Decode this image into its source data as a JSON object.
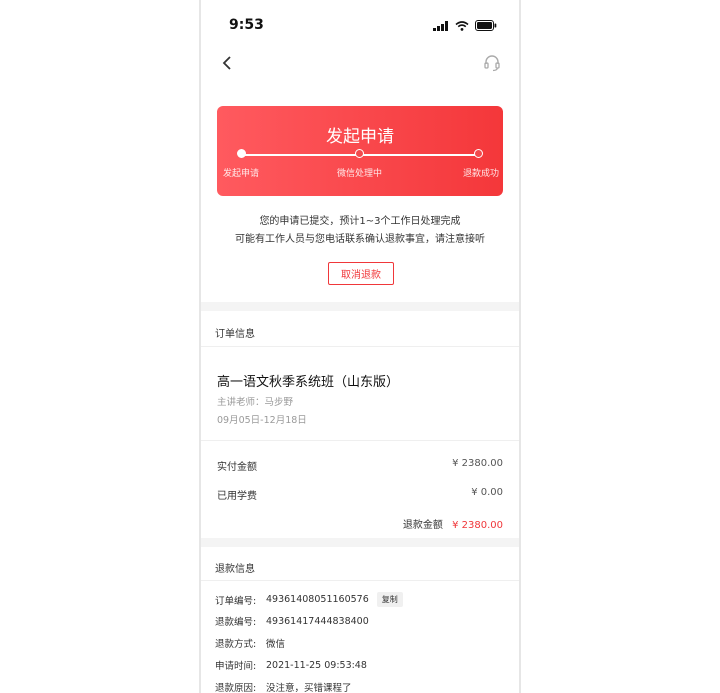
{
  "status_bar": {
    "time": "9:53"
  },
  "icons": {
    "back": "chevron-left-icon",
    "service": "headset-icon"
  },
  "hero": {
    "title": "发起申请",
    "steps": [
      "发起申请",
      "微信处理中",
      "退款成功"
    ],
    "completed_steps": 1
  },
  "notice": {
    "line1": "您的申请已提交，预计1~3个工作日处理完成",
    "line2": "可能有工作人员与您电话联系确认退款事宜，请注意接听",
    "cancel_label": "取消退款"
  },
  "order": {
    "section_title": "订单信息",
    "course_name": "高一语文秋季系统班（山东版）",
    "teacher": "主讲老师：马步野",
    "dates": "09月05日-12月18日",
    "paid_label": "实付金额",
    "paid_value": "¥ 2380.00",
    "used_label": "已用学费",
    "used_value": "¥ 0.00",
    "refund_label": "退款金额",
    "refund_value": "¥ 2380.00"
  },
  "refund": {
    "section_title": "退款信息",
    "rows": [
      {
        "key": "订单编号:",
        "value": "49361408051160576"
      },
      {
        "key": "退款编号:",
        "value": "49361417444838400"
      },
      {
        "key": "退款方式:",
        "value": "微信"
      },
      {
        "key": "申请时间:",
        "value": "2021-11-25 09:53:48"
      },
      {
        "key": "退款原因:",
        "value": "没注意，买错课程了"
      }
    ],
    "copy_label": "复制"
  },
  "colors": {
    "accent": "#f0373a",
    "hero_start": "#ff5a5f",
    "hero_end": "#f4373a"
  }
}
